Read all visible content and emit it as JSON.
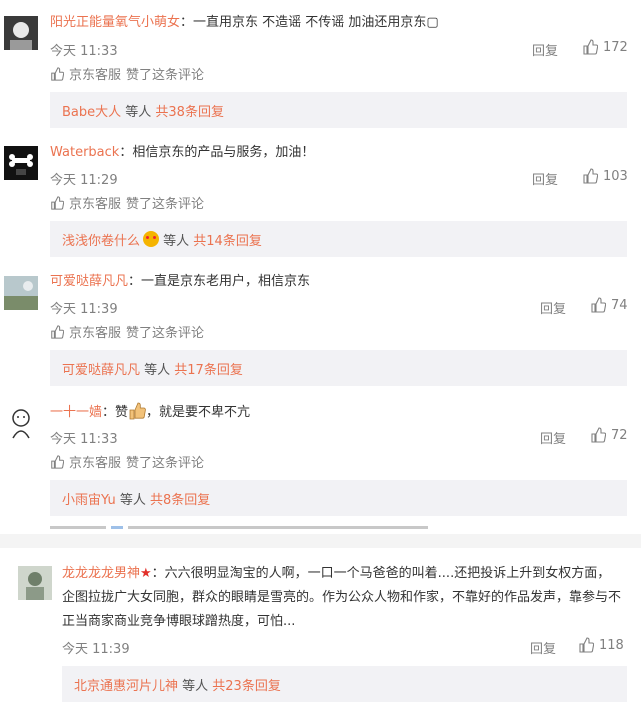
{
  "comments": [
    {
      "user": "阳光正能量氧气小萌女",
      "text": "：一直用京东 不造谣 不传谣 加油还用京东▢",
      "time": "今天 11:33",
      "reply": "回复",
      "likes": "172",
      "liked_by": "京东客服",
      "liked_suffix": "赞了这条评论",
      "sub_user": "Babe大人",
      "sub_mid": " 等人 ",
      "sub_count": "共38条回复"
    },
    {
      "user": "Waterback",
      "text": "：相信京东的产品与服务，加油！",
      "time": "今天 11:29",
      "reply": "回复",
      "likes": "103",
      "liked_by": "京东客服",
      "liked_suffix": "赞了这条评论",
      "sub_user": "浅浅你卷什么",
      "sub_mid": " 等人 ",
      "sub_count": "共14条回复"
    },
    {
      "user": "可爱哒薛凡凡",
      "text": "：一直是京东老用户，相信京东",
      "time": "今天 11:39",
      "reply": "回复",
      "likes": "74",
      "liked_by": "京东客服",
      "liked_suffix": "赞了这条评论",
      "sub_user": "可爱哒薛凡凡",
      "sub_mid": " 等人 ",
      "sub_count": "共17条回复"
    },
    {
      "user": "一十一嫱",
      "text_before": "：赞",
      "text_after": "，就是要不卑不亢",
      "time": "今天 11:33",
      "reply": "回复",
      "likes": "72",
      "liked_by": "京东客服",
      "liked_suffix": "赞了这条评论",
      "sub_user": "小雨宙Yu",
      "sub_mid": " 等人 ",
      "sub_count": "共8条回复"
    },
    {
      "user": "龙龙龙龙男神",
      "text": "：六六很明显淘宝的人啊，一口一个马爸爸的叫着....还把投诉上升到女权方面，企图拉拢广大女同胞，群众的眼睛是雪亮的。作为公众人物和作家，不靠好的作品发声，靠参与不正当商家商业竞争博眼球蹭热度，可怕...",
      "time": "今天 11:39",
      "reply": "回复",
      "likes": "118",
      "sub_user": "北京通惠河片儿神",
      "sub_mid": " 等人 ",
      "sub_count": "共23条回复"
    }
  ],
  "colors": {
    "username": "#eb7350",
    "meta": "#808080",
    "subbox_bg": "#f2f2f5",
    "separator": "#f4f4f4"
  }
}
